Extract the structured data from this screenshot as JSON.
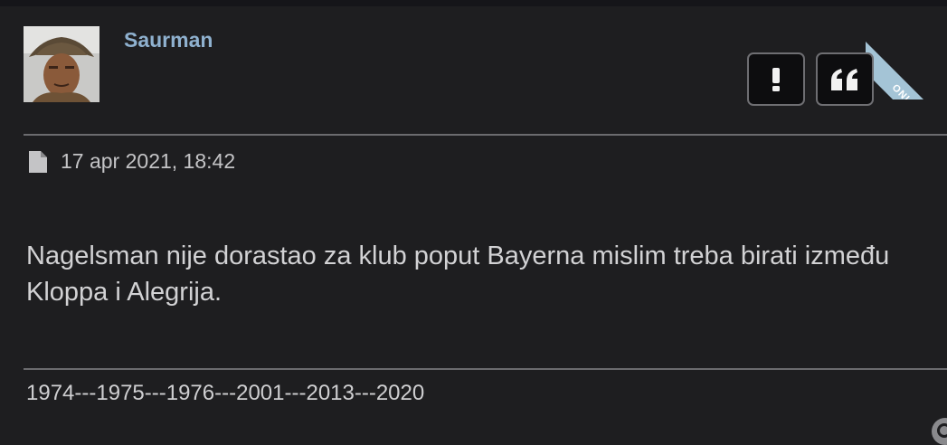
{
  "post": {
    "author": "Saurman",
    "online_badge": "ONLINE",
    "timestamp": "17 apr 2021, 18:42",
    "body": "Nagelsman nije dorastao za klub poput Bayerna mislim treba birati između Kloppa i Alegrija.",
    "signature": "1974---1975---1976---2001---2013---2020"
  },
  "actions": {
    "report_icon": "exclamation-icon",
    "quote_icon": "quote-icon"
  },
  "colors": {
    "background": "#1e1e20",
    "username": "#8fb1cf",
    "online_ribbon": "#a4c4d6",
    "text": "#d2d2d4",
    "divider": "#6b6b6e"
  }
}
